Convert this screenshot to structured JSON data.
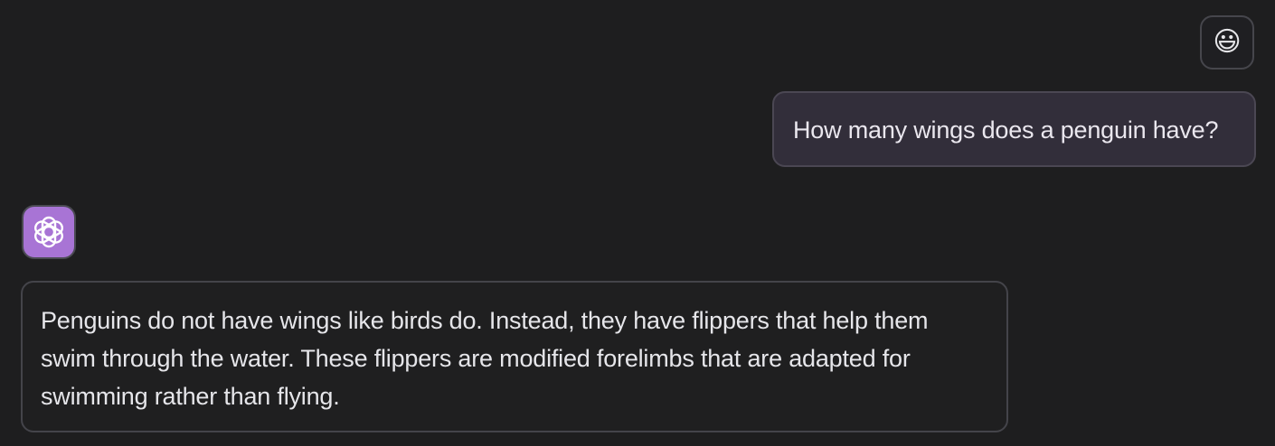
{
  "conversation": {
    "messages": [
      {
        "role": "user",
        "avatar_icon": "smiley-face-emoji",
        "avatar_glyph": "😃",
        "text": "How many wings does a penguin have?"
      },
      {
        "role": "assistant",
        "avatar_icon": "openai-logo-icon",
        "text": "Penguins do not have wings like birds do. Instead, they have flippers that help them swim through the water. These flippers are modified forelimbs that are adapted for swimming rather than flying."
      }
    ]
  },
  "colors": {
    "background": "#1e1e1f",
    "user_bubble": "#322e3a",
    "assistant_avatar": "#a874d5",
    "text": "#e7e7ea"
  }
}
